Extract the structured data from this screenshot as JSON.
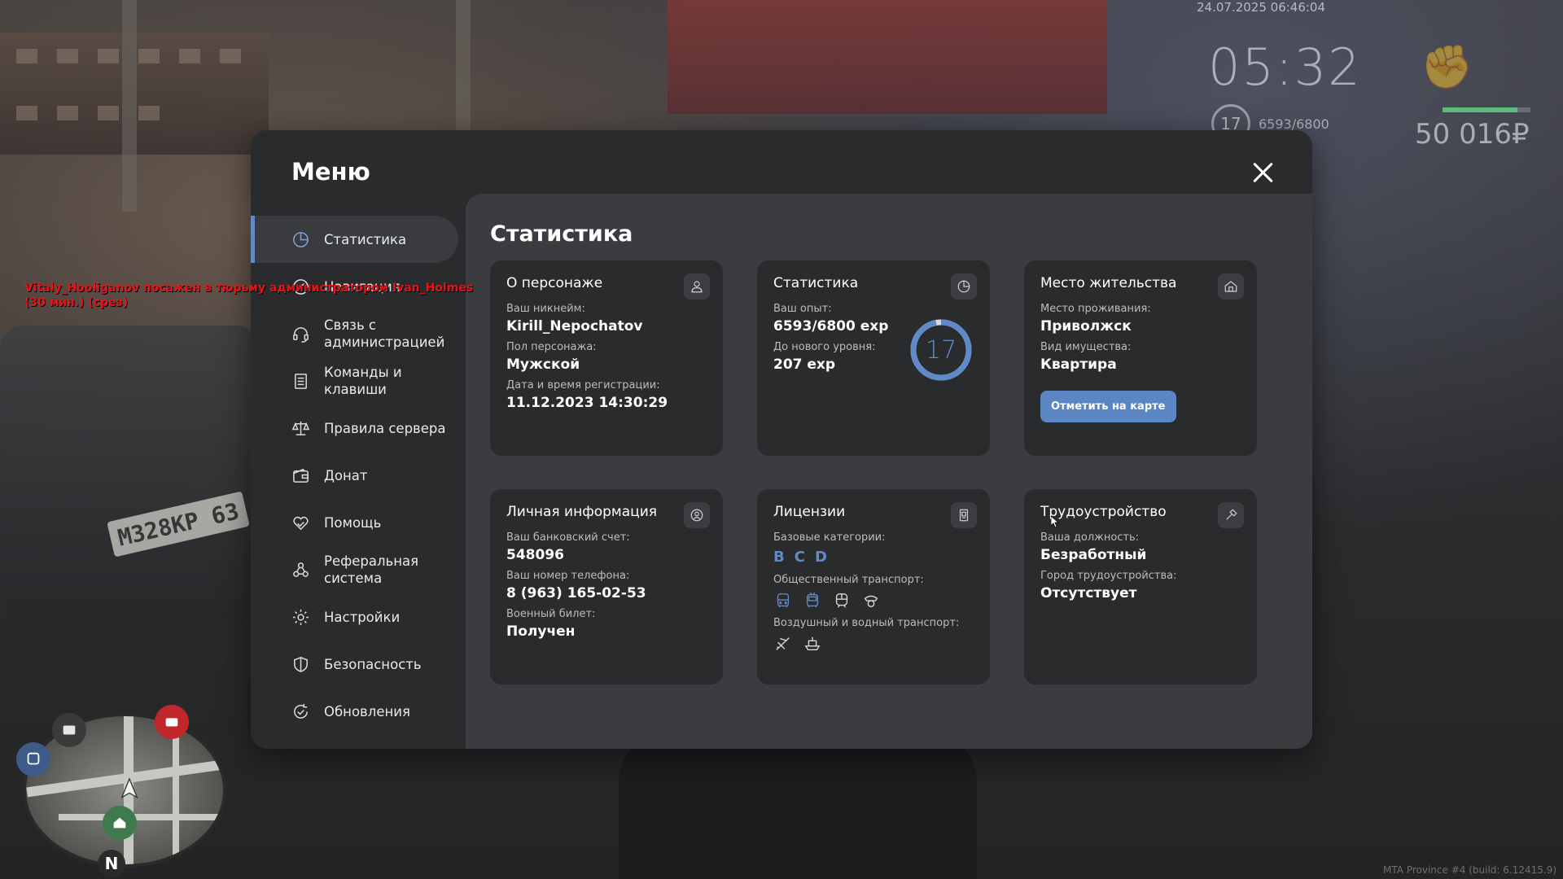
{
  "hud": {
    "datetime": "24.07.2025 06:46:04",
    "clock": "05:32",
    "level": "17",
    "exp": "6593/6800",
    "money": "50 016₽",
    "plate": "M328KP 63",
    "watermark": "MTA Province #4 (build: 6.12415.9)",
    "health_fraction": 0.85
  },
  "chat": {
    "message": "Vitaly_Hooliganov посажен в тюрьму администратором Ivan_Holmes (30 мин.) (срез)"
  },
  "menu": {
    "title": "Меню",
    "nav": [
      {
        "label": "Статистика",
        "icon": "pie-chart-icon",
        "active": true
      },
      {
        "label": "Навигация",
        "icon": "compass-icon",
        "active": false
      },
      {
        "label": "Связь с администрацией",
        "icon": "headset-icon",
        "active": false
      },
      {
        "label": "Команды и клавиши",
        "icon": "document-icon",
        "active": false
      },
      {
        "label": "Правила сервера",
        "icon": "scales-icon",
        "active": false
      },
      {
        "label": "Донат",
        "icon": "wallet-icon",
        "active": false
      },
      {
        "label": "Помощь",
        "icon": "handshake-heart-icon",
        "active": false
      },
      {
        "label": "Реферальная система",
        "icon": "people-network-icon",
        "active": false
      },
      {
        "label": "Настройки",
        "icon": "gear-icon",
        "active": false
      },
      {
        "label": "Безопасность",
        "icon": "shield-icon",
        "active": false
      },
      {
        "label": "Обновления",
        "icon": "refresh-check-icon",
        "active": false
      }
    ]
  },
  "content": {
    "title": "Статистика",
    "character": {
      "title": "О персонаже",
      "icon": "user-icon",
      "nickname_label": "Ваш никнейм:",
      "nickname": "Kirill_Nepochatov",
      "gender_label": "Пол персонажа:",
      "gender": "Мужской",
      "reg_label": "Дата и время регистрации:",
      "reg": "11.12.2023 14:30:29"
    },
    "stats": {
      "title": "Статистика",
      "icon": "pie-chart-icon",
      "exp_label": "Ваш опыт:",
      "exp": "6593/6800 exp",
      "next_label": "До нового уровня:",
      "next": "207 exp",
      "level": "17",
      "progress_fraction": 0.97,
      "accent": "#5f8ac7"
    },
    "residence": {
      "title": "Место жительства",
      "icon": "house-icon",
      "place_label": "Место проживания:",
      "place": "Приволжск",
      "property_label": "Вид имущества:",
      "property": "Квартира",
      "button": "Отметить на карте"
    },
    "personal": {
      "title": "Личная информация",
      "icon": "id-circle-icon",
      "bank_label": "Ваш банковский счет:",
      "bank": "548096",
      "phone_label": "Ваш номер телефона:",
      "phone": "8 (963) 165-02-53",
      "military_label": "Военный билет:",
      "military": "Получен"
    },
    "licenses": {
      "title": "Лицензии",
      "icon": "license-doc-icon",
      "base_label": "Базовые категории:",
      "categories": [
        "B",
        "C",
        "D"
      ],
      "public_label": "Общественный транспорт:",
      "air_label": "Воздушный и водный транспорт:"
    },
    "employment": {
      "title": "Трудоустройство",
      "icon": "hammer-icon",
      "position_label": "Ваша должность:",
      "position": "Безработный",
      "city_label": "Город трудоустройства:",
      "city": "Отсутствует"
    }
  }
}
